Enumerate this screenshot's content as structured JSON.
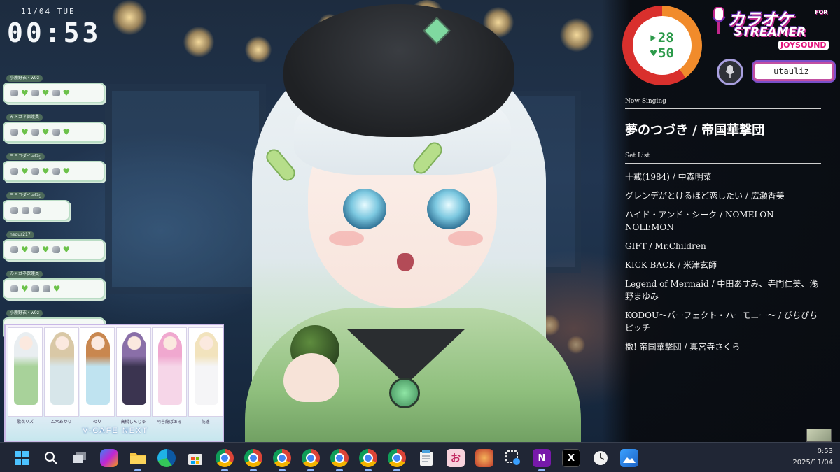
{
  "clock": {
    "date": "11/04 TUE",
    "time": "00:53"
  },
  "chat": [
    {
      "name": "小鹿野衣・w9z",
      "emotes": [
        "emote",
        "heart",
        "emote",
        "heart",
        "emote",
        "heart"
      ]
    },
    {
      "name": "みメガネ保護員",
      "emotes": [
        "emote",
        "heart",
        "emote",
        "heart",
        "emote",
        "heart"
      ]
    },
    {
      "name": "ヨヨコダイ-el2g",
      "emotes": [
        "emote",
        "heart",
        "emote",
        "heart",
        "emote",
        "heart"
      ]
    },
    {
      "name": "ヨヨコダイ-el2g",
      "emotes": [
        "emote",
        "emote",
        "emote"
      ]
    },
    {
      "name": "nedus217",
      "emotes": [
        "emote",
        "heart",
        "emote",
        "heart",
        "emote",
        "heart"
      ]
    },
    {
      "name": "みメガネ保護員",
      "emotes": [
        "emote",
        "heart",
        "emote",
        "emote",
        "heart"
      ]
    },
    {
      "name": "小鹿野衣・w9z",
      "emotes": [
        "emote",
        "emote",
        "emote",
        "emote",
        "emote"
      ]
    }
  ],
  "poster": {
    "title": "V-CAFE NEXT",
    "talents": [
      {
        "name": "歌衣リズ",
        "hair": "#e9eef1",
        "outfit": "#a8d29a"
      },
      {
        "name": "乙木あかり",
        "hair": "#d9c8a6",
        "outfit": "#d7e6ea"
      },
      {
        "name": "のり",
        "hair": "#c9874f",
        "outfit": "#bfe3f0"
      },
      {
        "name": "高橋しんじゅ",
        "hair": "#8a6fa8",
        "outfit": "#3b3450"
      },
      {
        "name": "阿吉龍ぱぁる",
        "hair": "#f0a8cf",
        "outfit": "#f6d6e8"
      },
      {
        "name": "花遥",
        "hair": "#f2e3bd",
        "outfit": "#f5f5f7"
      }
    ]
  },
  "score": {
    "up": "28",
    "heart": "50"
  },
  "logo": {
    "line1": "カラオケ",
    "for": "FOR",
    "line2": "STREAMER",
    "brand": "JOYSOUND"
  },
  "user": {
    "name": "utauliz_"
  },
  "now_singing": {
    "label": "Now Singing",
    "title": "夢のつづき / 帝国華撃団"
  },
  "setlist": {
    "label": "Set List",
    "items": [
      "十戒(1984) / 中森明菜",
      "グレンデがとけるほど恋したい / 広瀬香美",
      "ハイド・アンド・シーク / NOMELON NOLEMON",
      "GIFT / Mr.Children",
      "KICK BACK / 米津玄師",
      "Legend of Mermaid / 中田あすみ、寺門仁美、浅野まゆみ",
      "KODOU〜パーフェクト・ハーモニー〜 / ぴちぴちピッチ",
      "檄! 帝国華撃団 / 真宮寺さくら"
    ]
  },
  "taskbar": {
    "time": "0:53",
    "date": "2025/11/04"
  },
  "colors": {
    "ring_red": "#d9302d",
    "ring_orange": "#f18b2b",
    "score_green": "#2c9a4a",
    "taskbar": "#202635"
  }
}
